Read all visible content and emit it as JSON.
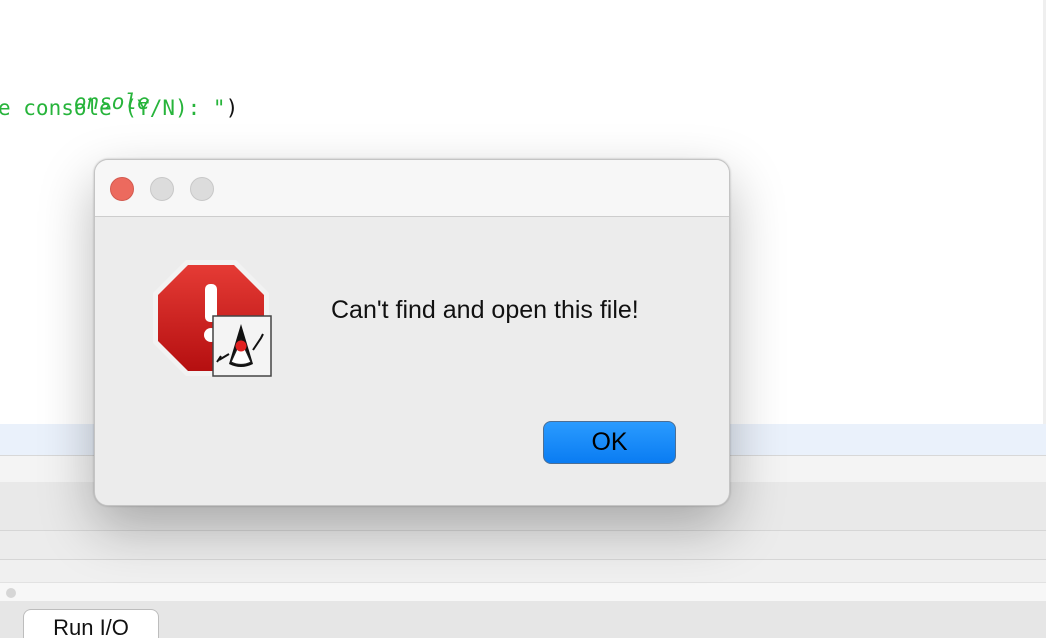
{
  "editor": {
    "line1": {
      "comment": "onsole"
    },
    "line2": {
      "string": "e console (Y/N): \"",
      "close": ")"
    }
  },
  "bottom_panel": {
    "tab_label": "Run I/O"
  },
  "dialog": {
    "message": "Can't find and open this file!",
    "ok_label": "OK",
    "icon": "error-stop-sign-icon",
    "badge_icon": "java-duke-icon"
  },
  "colors": {
    "accent": "#0a7cf2",
    "error_red": "#d91c1c",
    "code_green": "#27b43b"
  }
}
